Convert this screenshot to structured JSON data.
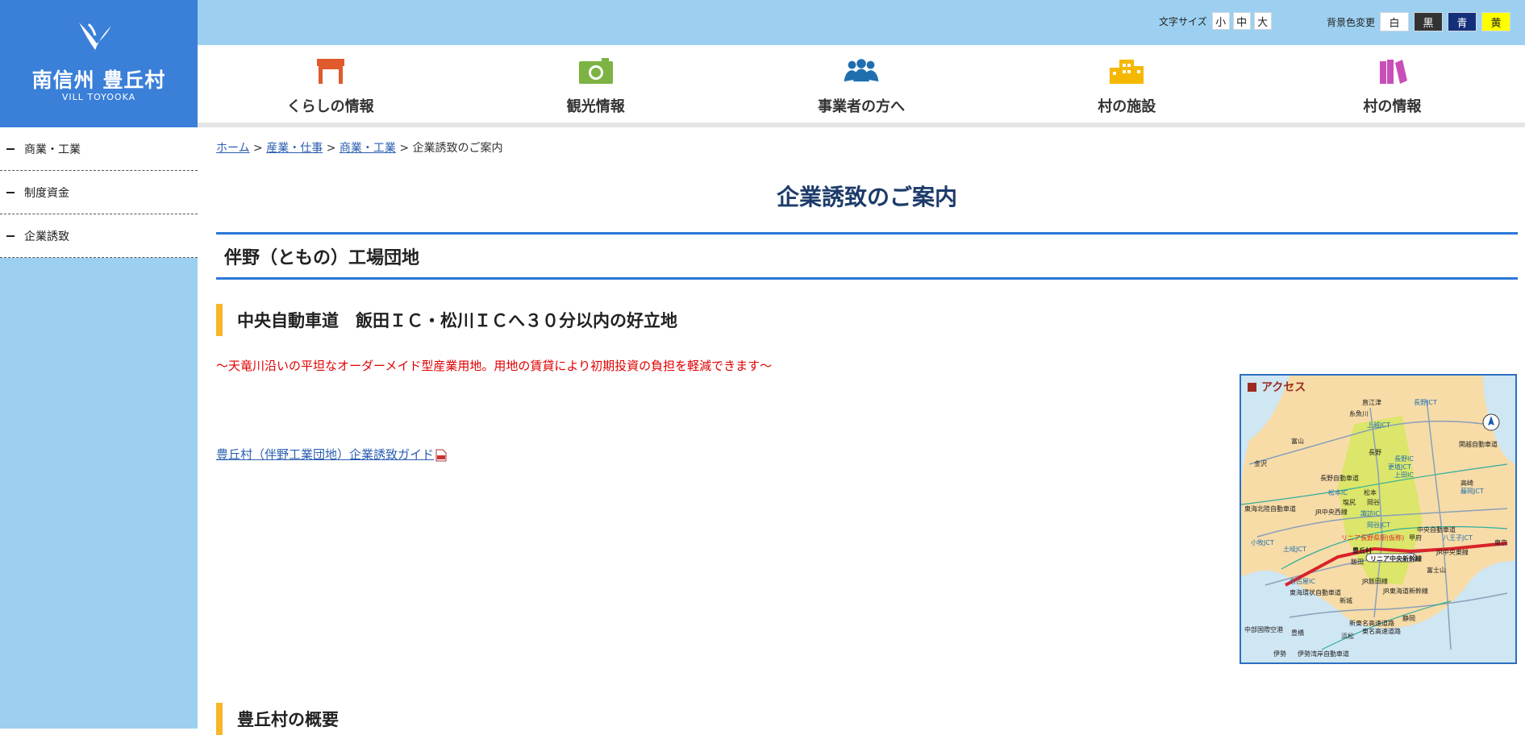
{
  "logo": {
    "name": "南信州 豊丘村",
    "sub": "VILL TOYOOKA"
  },
  "sidebar": {
    "items": [
      {
        "label": "商業・工業"
      },
      {
        "label": "制度資金"
      },
      {
        "label": "企業誘致"
      }
    ]
  },
  "toolbar": {
    "font_size_label": "文字サイズ",
    "sizes": [
      "小",
      "中",
      "大"
    ],
    "bg_label": "背景色変更",
    "bg_colors": [
      {
        "label": "白",
        "bg": "#ffffff",
        "fg": "#222222"
      },
      {
        "label": "黒",
        "bg": "#333333",
        "fg": "#ffffff"
      },
      {
        "label": "青",
        "bg": "#14307a",
        "fg": "#ffffff"
      },
      {
        "label": "黄",
        "bg": "#ffff00",
        "fg": "#222222"
      }
    ]
  },
  "nav": {
    "items": [
      {
        "label": "くらしの情報",
        "icon": "house-icon",
        "color": "#e05a2b"
      },
      {
        "label": "観光情報",
        "icon": "camera-icon",
        "color": "#7cb342"
      },
      {
        "label": "事業者の方へ",
        "icon": "people-icon",
        "color": "#1f6fb0"
      },
      {
        "label": "村の施設",
        "icon": "building-icon",
        "color": "#f5b800"
      },
      {
        "label": "村の情報",
        "icon": "book-icon",
        "color": "#c94fb8"
      }
    ]
  },
  "breadcrumb": {
    "links": [
      "ホーム",
      "産業・仕事",
      "商業・工業"
    ],
    "separator": ">",
    "current": "企業誘致のご案内"
  },
  "page": {
    "title": "企業誘致のご案内",
    "section_title": "伴野（ともの）工場団地",
    "subheading": "中央自動車道　飯田ＩＣ・松川ＩＣへ３０分以内の好立地",
    "lead": "～天竜川沿いの平坦なオーダーメイド型産業用地。用地の賃貸により初期投資の負担を軽減できます～",
    "guide_link": "豊丘村（伴野工業団地）企業誘致ガイド",
    "subheading2": "豊丘村の概要"
  },
  "map": {
    "title": "アクセス",
    "labels": [
      "直江津",
      "長野JCT",
      "糸魚川",
      "上越JCT",
      "富山",
      "長野",
      "長野IC",
      "金沢",
      "更埴JCT",
      "上田IC",
      "関越自動車道",
      "長野自動車道",
      "松本IC",
      "松本",
      "高崎",
      "藤岡JCT",
      "東海北陸自動車道",
      "塩尻",
      "岡谷",
      "JR中央西線",
      "諏訪IC",
      "岡谷JCT",
      "中央自動車道",
      "リニア長野県駅(仮称)",
      "豊丘村",
      "甲府",
      "八王子JCT",
      "小牧JCT",
      "土岐JCT",
      "飯田",
      "東京",
      "リニア中央新幹線",
      "JR中央東線",
      "名古屋IC",
      "富士山",
      "JR飯田線",
      "東海環状自動車道",
      "新城",
      "JR東海道新幹線",
      "豊橋",
      "静岡",
      "浜松",
      "伊勢湾岸自動車道",
      "新東名高速道路",
      "東名高速道路",
      "中部国際空港",
      "伊勢"
    ]
  }
}
